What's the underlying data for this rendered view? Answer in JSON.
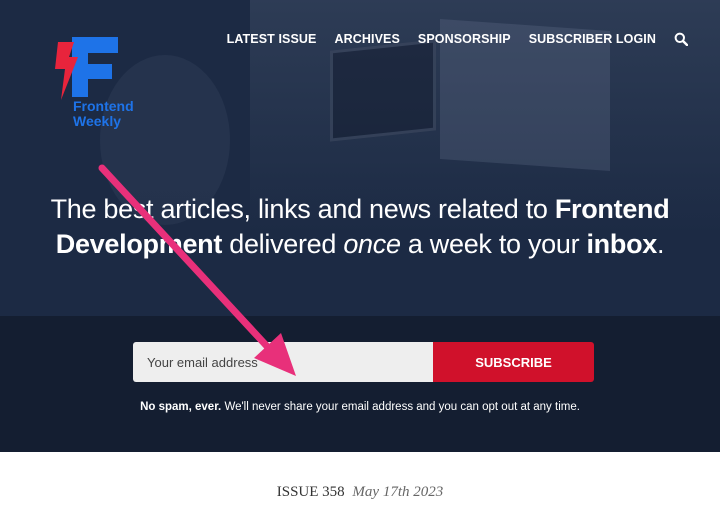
{
  "brand": {
    "name_line1": "Frontend",
    "name_line2": "Weekly",
    "colors": {
      "blue": "#1e73e8",
      "red": "#e8243c"
    }
  },
  "nav": {
    "items": [
      {
        "label": "LATEST ISSUE"
      },
      {
        "label": "ARCHIVES"
      },
      {
        "label": "SPONSORSHIP"
      },
      {
        "label": "SUBSCRIBER LOGIN"
      }
    ],
    "search_icon": "search-icon"
  },
  "hero": {
    "headline": {
      "t1": "The best articles, links and news related to ",
      "b1": "Frontend Development",
      "t2": " delivered ",
      "i1": "once",
      "t3": " a week to your ",
      "b2": "inbox",
      "t4": "."
    }
  },
  "signup": {
    "email_placeholder": "Your email address",
    "subscribe_label": "SUBSCRIBE",
    "note_bold": "No spam, ever.",
    "note_text": " We'll never share your email address and you can opt out at any time."
  },
  "issue": {
    "label": "ISSUE 358",
    "date": "May 17th 2023"
  },
  "annotation": {
    "arrow_color": "#e8307a"
  }
}
